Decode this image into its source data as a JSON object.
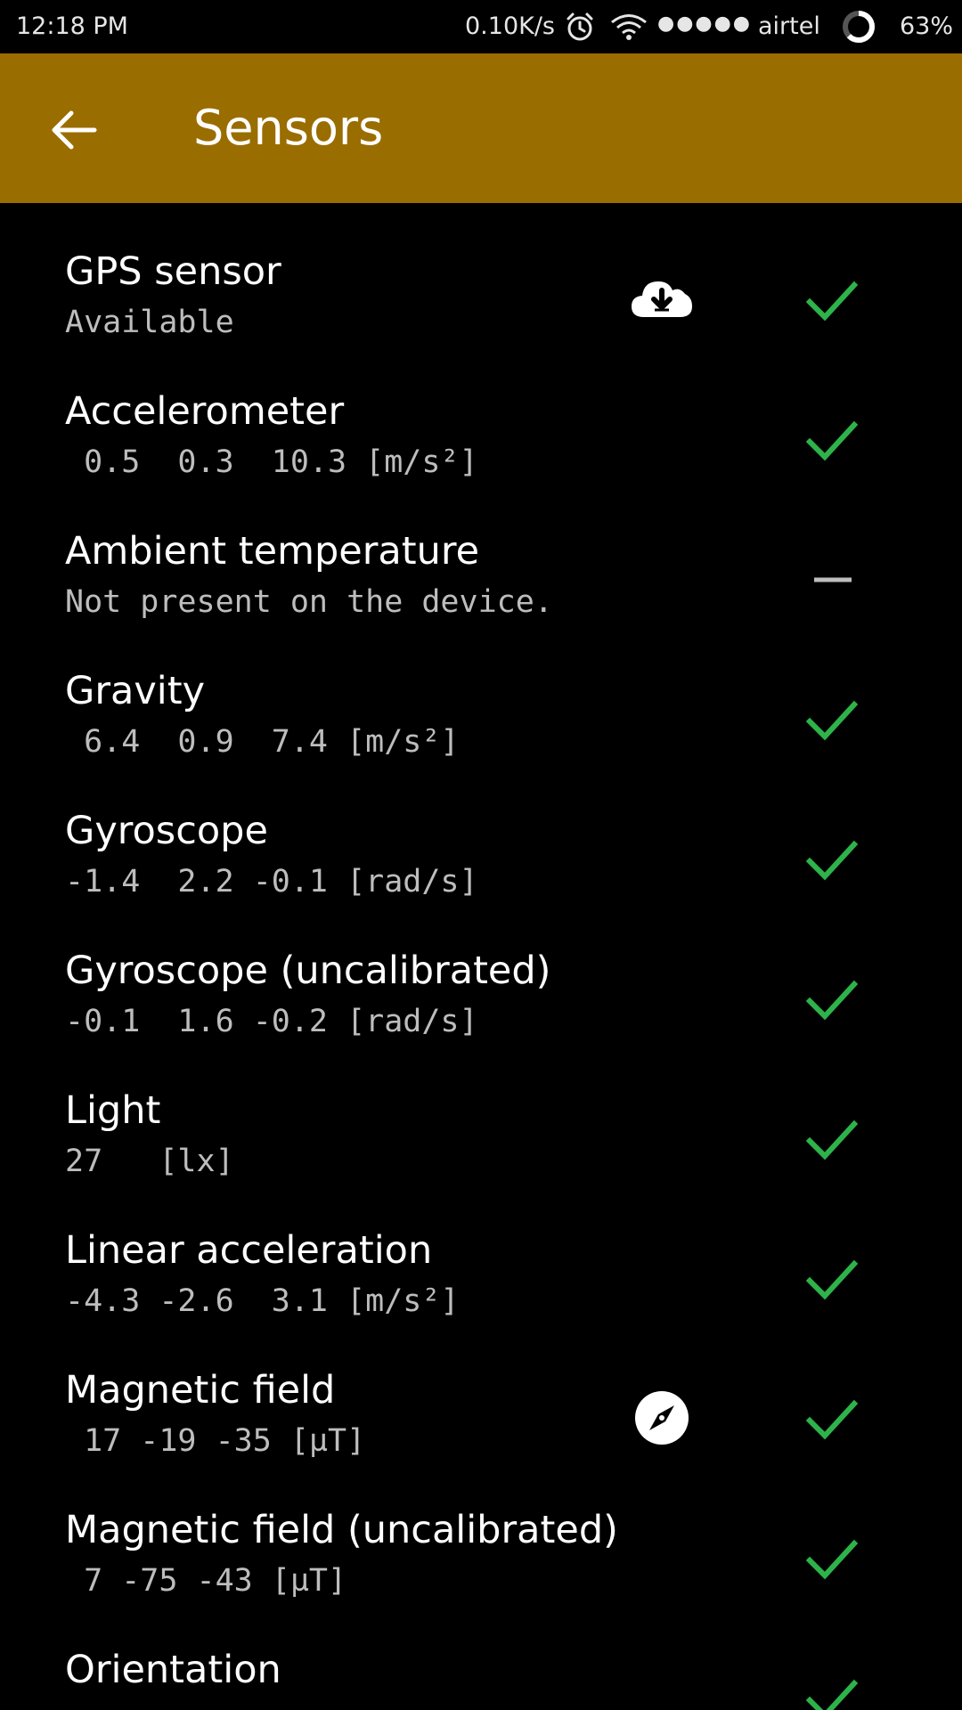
{
  "status_bar": {
    "time": "12:18 PM",
    "net_speed": "0.10K/s",
    "signal": "●●●●●",
    "carrier": "airtel",
    "battery": "63%"
  },
  "app_bar": {
    "title": "Sensors",
    "back_icon": "arrow-back-icon",
    "color": "#9a6d00"
  },
  "colors": {
    "check": "#2db34a",
    "dash": "#bdbdbd"
  },
  "sensors": [
    {
      "name": "GPS sensor",
      "value": "Available",
      "status": "check",
      "extra": "cloud-download-icon"
    },
    {
      "name": "Accelerometer",
      "value": " 0.5  0.3  10.3 [m/s²]",
      "status": "check"
    },
    {
      "name": "Ambient temperature",
      "value": "Not present on the device.",
      "status": "dash"
    },
    {
      "name": "Gravity",
      "value": " 6.4  0.9  7.4 [m/s²]",
      "status": "check"
    },
    {
      "name": "Gyroscope",
      "value": "-1.4  2.2 -0.1 [rad/s]",
      "status": "check"
    },
    {
      "name": "Gyroscope (uncalibrated)",
      "value": "-0.1  1.6 -0.2 [rad/s]",
      "status": "check"
    },
    {
      "name": "Light",
      "value": "27   [lx]",
      "status": "check"
    },
    {
      "name": "Linear acceleration",
      "value": "-4.3 -2.6  3.1 [m/s²]",
      "status": "check"
    },
    {
      "name": "Magnetic field",
      "value": " 17 -19 -35 [µT]",
      "status": "check",
      "extra": "compass-icon"
    },
    {
      "name": "Magnetic field (uncalibrated)",
      "value": " 7 -75 -43 [µT]",
      "status": "check"
    },
    {
      "name": "Orientation",
      "value": "",
      "status": "check"
    }
  ]
}
